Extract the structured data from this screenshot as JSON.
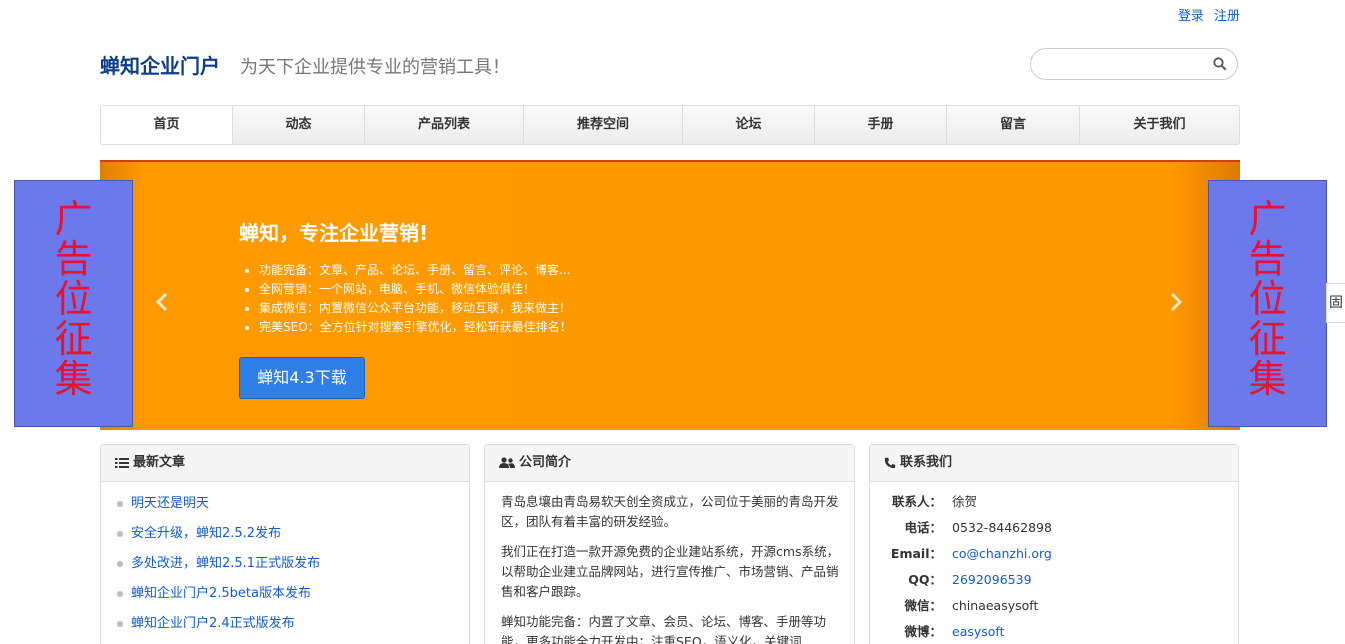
{
  "topbar": {
    "login": "登录",
    "register": "注册"
  },
  "brand": {
    "name": "蝉知企业门户",
    "slogan": "为天下企业提供专业的营销工具！"
  },
  "search": {
    "placeholder": ""
  },
  "nav": {
    "items": [
      {
        "label": "首页",
        "active": true
      },
      {
        "label": "动态"
      },
      {
        "label": "产品列表"
      },
      {
        "label": "推荐空间"
      },
      {
        "label": "论坛"
      },
      {
        "label": "手册"
      },
      {
        "label": "留言"
      },
      {
        "label": "关于我们"
      }
    ]
  },
  "banner": {
    "title": "蝉知，专注企业营销!",
    "bullets": [
      "功能完备：文章、产品、论坛、手册、留言、评论、博客...",
      "全网营销：一个网站，电脑、手机、微信体验俱佳！",
      "集成微信：内置微信公众平台功能，移动互联，我来做主！",
      "完美SEO：全方位针对搜索引擎优化，轻松斩获最佳排名！"
    ],
    "button": "蝉知4.3下载",
    "color": "#ff9900"
  },
  "ads": {
    "left": "广告位征集",
    "right": "广告位征集",
    "bg": "#6b79ea",
    "text_color": "#ea1030"
  },
  "side_tab": {
    "label": "固"
  },
  "panels": {
    "articles": {
      "title": "最新文章",
      "icon": "list-icon",
      "items": [
        "明天还是明天",
        "安全升级，蝉知2.5.2发布",
        "多处改进，蝉知2.5.1正式版发布",
        "蝉知企业门户2.5beta版本发布",
        "蝉知企业门户2.4正式版发布"
      ]
    },
    "about": {
      "title": "公司简介",
      "icon": "users-icon",
      "paragraphs": [
        "青岛息壤由青岛易软天创全资成立，公司位于美丽的青岛开发区，团队有着丰富的研发经验。",
        "我们正在打造一款开源免费的企业建站系统，开源cms系统，以帮助企业建立品牌网站，进行宣传推广、市场营销、产品销售和客户跟踪。",
        "蝉知功能完备：内置了文章、会员、论坛、博客、手册等功能，更多功能全力开发中；注重SEO，语义化，关键词"
      ]
    },
    "contact": {
      "title": "联系我们",
      "icon": "phone-icon",
      "rows": [
        {
          "k": "联系人：",
          "v": "徐贺"
        },
        {
          "k": "电话：",
          "v": "0532-84462898"
        },
        {
          "k": "Email：",
          "v": "co@chanzhi.org"
        },
        {
          "k": "QQ：",
          "v": "2692096539"
        },
        {
          "k": "微信：",
          "v": "chinaeasysoft"
        },
        {
          "k": "微博：",
          "v": "easysoft"
        }
      ]
    }
  },
  "colors": {
    "link": "#145ccd",
    "brand": "#0d3d88",
    "button": "#2f7fe8"
  }
}
